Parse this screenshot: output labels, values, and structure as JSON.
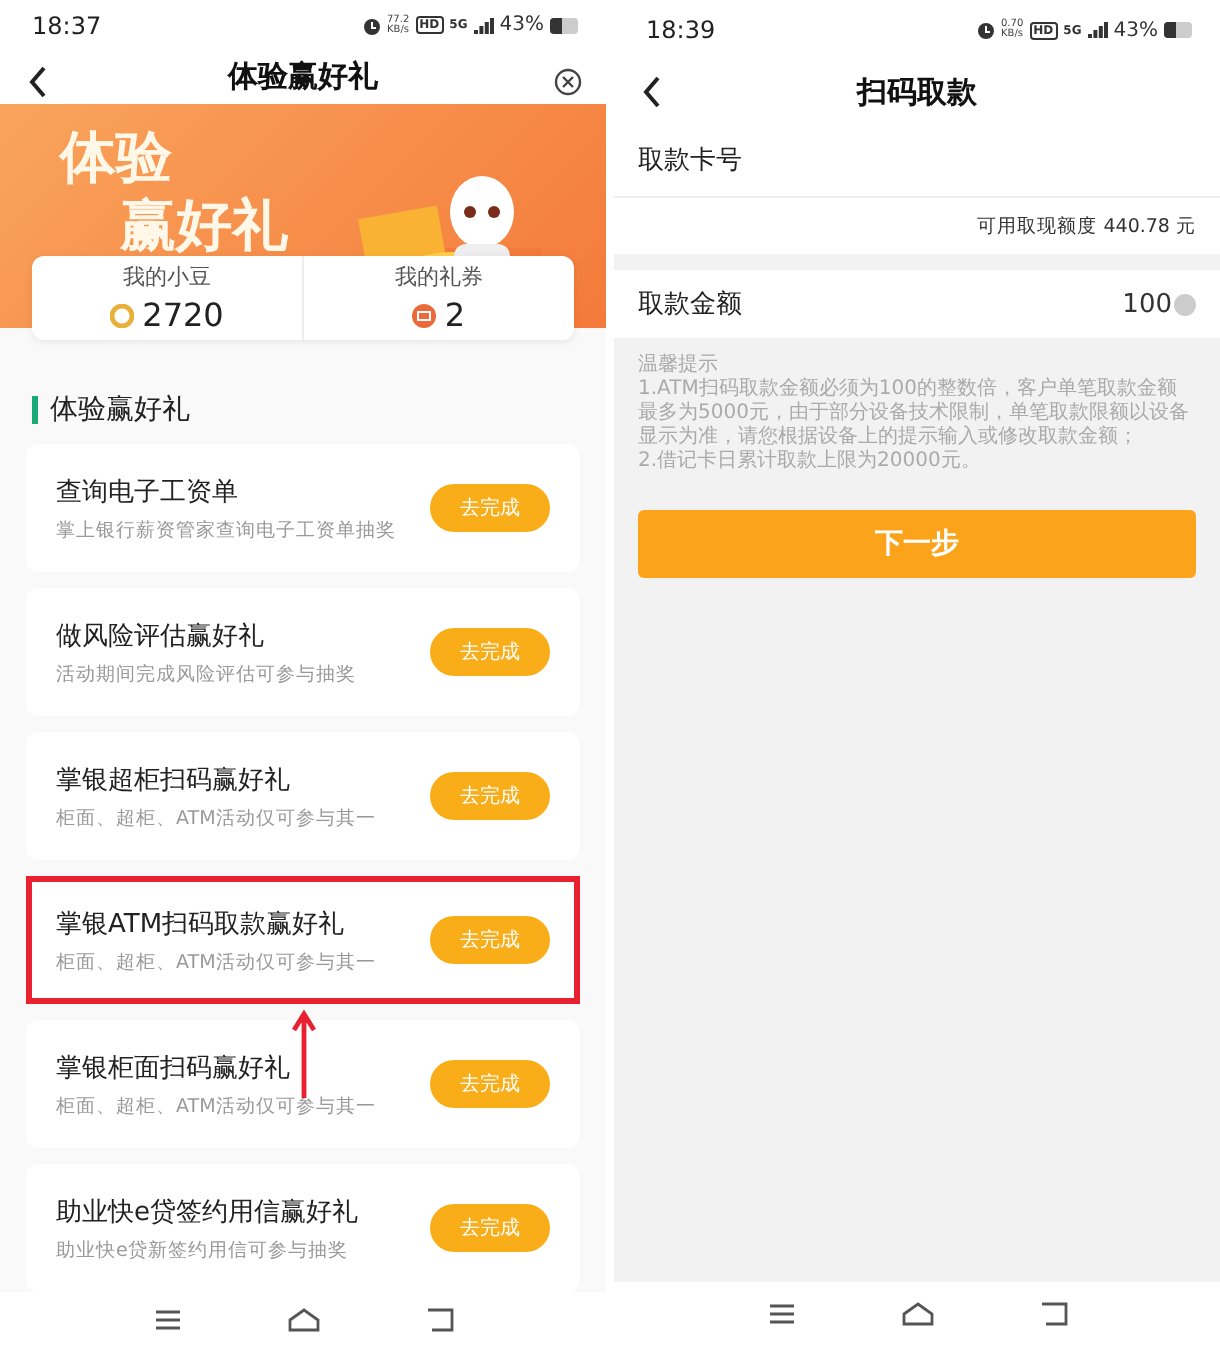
{
  "left_screen": {
    "status_bar": {
      "time": "18:37",
      "speed": "77.2",
      "speed_unit": "KB/s",
      "hd": "HD",
      "network": "5G",
      "battery": "43%"
    },
    "title": "体验赢好礼",
    "banner": {
      "lines": [
        "体验",
        "赢好礼"
      ]
    },
    "stats": [
      {
        "label": "我的小豆",
        "value": "2720",
        "kind": "coin"
      },
      {
        "label": "我的礼券",
        "value": "2",
        "kind": "coupon"
      }
    ],
    "section_title": "体验赢好礼",
    "tasks": [
      {
        "title": "查询电子工资单",
        "desc": "掌上银行薪资管家查询电子工资单抽奖",
        "button": "去完成",
        "highlighted": false
      },
      {
        "title": "做风险评估赢好礼",
        "desc": "活动期间完成风险评估可参与抽奖",
        "button": "去完成",
        "highlighted": false
      },
      {
        "title": "掌银超柜扫码赢好礼",
        "desc": "柜面、超柜、ATM活动仅可参与其一",
        "button": "去完成",
        "highlighted": false
      },
      {
        "title": "掌银ATM扫码取款赢好礼",
        "desc": "柜面、超柜、ATM活动仅可参与其一",
        "button": "去完成",
        "highlighted": true
      },
      {
        "title": "掌银柜面扫码赢好礼",
        "desc": "柜面、超柜、ATM活动仅可参与其一",
        "button": "去完成",
        "highlighted": false
      },
      {
        "title": "助业快e贷签约用信赢好礼",
        "desc": "助业快e贷新签约用信可参与抽奖",
        "button": "去完成",
        "highlighted": false
      }
    ]
  },
  "right_screen": {
    "status_bar": {
      "time": "18:39",
      "speed": "0.70",
      "speed_unit": "KB/s",
      "hd": "HD",
      "network": "5G",
      "battery": "43%"
    },
    "title": "扫码取款",
    "card_label": "取款卡号",
    "limit": "可用取现额度 440.78 元",
    "amount_label": "取款金额",
    "amount_value": "100",
    "tips_title": "温馨提示",
    "tips": [
      "1.ATM扫码取款金额必须为100的整数倍，客户单笔取款金额最多为5000元，由于部分设备技术限制，单笔取款限额以设备显示为准，请您根据设备上的提示输入或修改取款金额；",
      "2.借记卡日累计取款上限为20000元。"
    ],
    "button": "下一步"
  }
}
